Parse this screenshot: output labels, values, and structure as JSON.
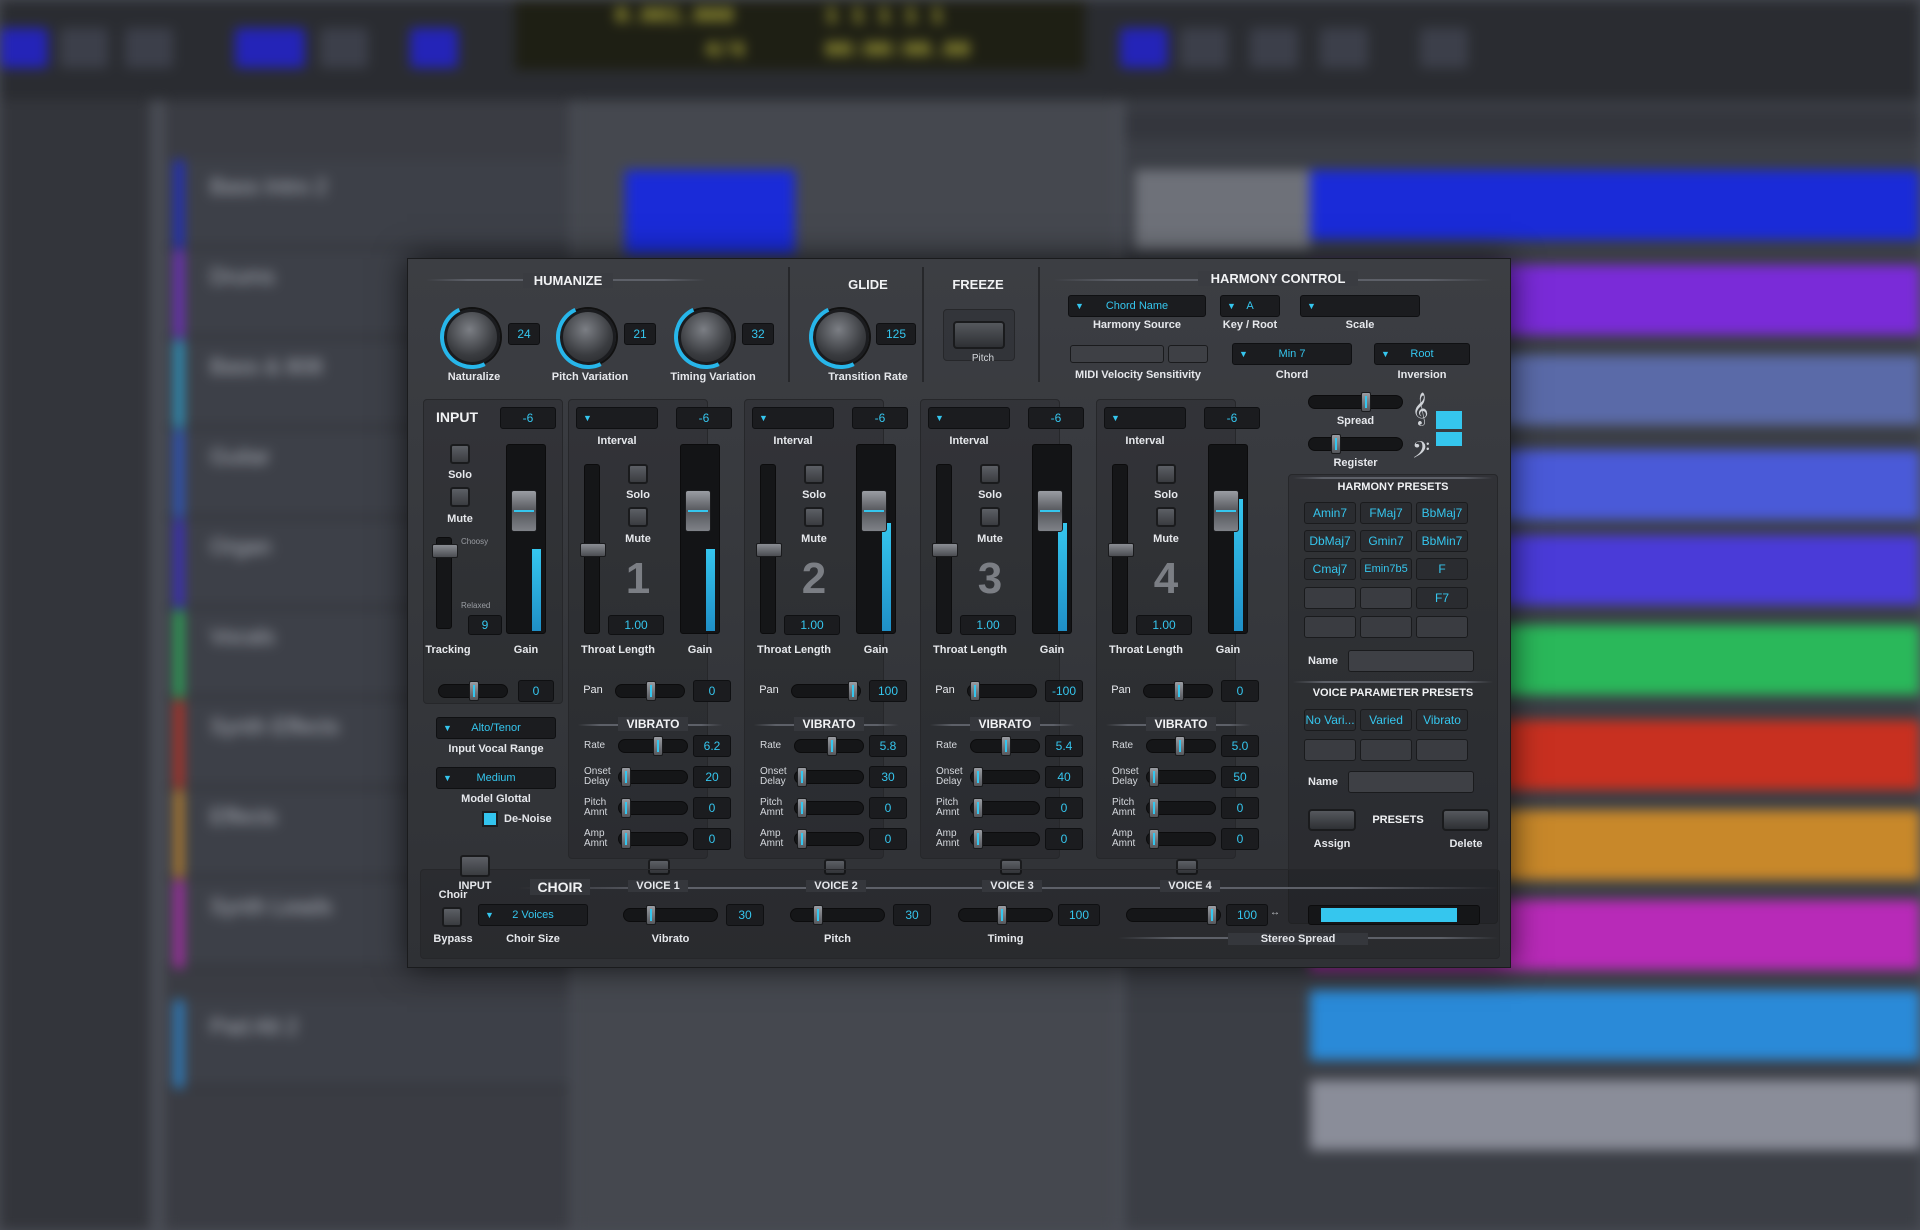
{
  "colors": {
    "accent": "#35c6ee",
    "panel": "#34363b"
  },
  "humanize": {
    "title": "HUMANIZE",
    "naturalize": {
      "label": "Naturalize",
      "value": "24"
    },
    "pitch_variation": {
      "label": "Pitch Variation",
      "value": "21"
    },
    "timing_variation": {
      "label": "Timing Variation",
      "value": "32"
    }
  },
  "glide": {
    "title": "GLIDE",
    "label": "Transition Rate",
    "value": "125"
  },
  "freeze": {
    "title": "FREEZE",
    "label": "Pitch"
  },
  "harmony": {
    "title": "HARMONY CONTROL",
    "source": {
      "label": "Harmony Source",
      "value": "Chord Name"
    },
    "key": {
      "label": "Key / Root",
      "value": "A"
    },
    "scale": {
      "label": "Scale",
      "value": ""
    },
    "midi_label": "MIDI Velocity Sensitivity",
    "chord": {
      "label": "Chord",
      "value": "Min 7"
    },
    "inversion": {
      "label": "Inversion",
      "value": "Root"
    },
    "spread_label": "Spread",
    "register_label": "Register"
  },
  "input": {
    "title": "INPUT",
    "gain_value": "-6",
    "solo": "Solo",
    "mute": "Mute",
    "choosy": "Choosy",
    "relaxed": "Relaxed",
    "tracking_label": "Tracking",
    "tracking_value": "9",
    "gain_label": "Gain",
    "pan_value": "0",
    "vocal_range": {
      "label": "Input Vocal Range",
      "value": "Alto/Tenor"
    },
    "glottal": {
      "label": "Model Glottal",
      "value": "Medium"
    },
    "denoise": "De-Noise"
  },
  "voices": [
    {
      "num": "1",
      "gain": "-6",
      "interval": "",
      "throat": "1.00",
      "pan": "0",
      "rate": "6.2",
      "onset": "20",
      "pitch": "0",
      "amp": "0"
    },
    {
      "num": "2",
      "gain": "-6",
      "interval": "",
      "throat": "1.00",
      "pan": "100",
      "rate": "5.8",
      "onset": "30",
      "pitch": "0",
      "amp": "0"
    },
    {
      "num": "3",
      "gain": "-6",
      "interval": "",
      "throat": "1.00",
      "pan": "-100",
      "rate": "5.4",
      "onset": "40",
      "pitch": "0",
      "amp": "0"
    },
    {
      "num": "4",
      "gain": "-6",
      "interval": "",
      "throat": "1.00",
      "pan": "0",
      "rate": "5.0",
      "onset": "50",
      "pitch": "0",
      "amp": "0"
    }
  ],
  "voice_labels": {
    "interval": "Interval",
    "solo": "Solo",
    "mute": "Mute",
    "throat": "Throat Length",
    "gain": "Gain",
    "pan": "Pan",
    "vibrato": "VIBRATO",
    "rate": "Rate",
    "onset": "Onset Delay",
    "pitch": "Pitch Amnt",
    "amp": "Amp Amnt"
  },
  "harmony_presets": {
    "title": "HARMONY PRESETS",
    "items": [
      "Amin7",
      "FMaj7",
      "BbMaj7",
      "DbMaj7",
      "Gmin7",
      "BbMin7",
      "Cmaj7",
      "Emin7b5",
      "F",
      "",
      "",
      "F7",
      "",
      "",
      ""
    ],
    "name_label": "Name"
  },
  "voice_presets": {
    "title": "VOICE PARAMETER PRESETS",
    "items": [
      "No Vari...",
      "Varied",
      "Vibrato",
      "",
      "",
      ""
    ],
    "name_label": "Name",
    "presets_label": "PRESETS",
    "assign": "Assign",
    "delete": "Delete"
  },
  "choir": {
    "choir_label": "Choir",
    "bypass": "Bypass",
    "input": "INPUT",
    "title": "CHOIR",
    "voice1": "VOICE 1",
    "voice2": "VOICE 2",
    "voice3": "VOICE 3",
    "voice4": "VOICE 4",
    "size": {
      "label": "Choir Size",
      "value": "2 Voices"
    },
    "vibrato": {
      "label": "Vibrato",
      "value": "30"
    },
    "pitch": {
      "label": "Pitch",
      "value": "30"
    },
    "timing": {
      "label": "Timing",
      "value": "100"
    },
    "spread": {
      "label": "Stereo Spread",
      "value": "100"
    }
  },
  "background": {
    "lcd": [
      "0.001.000",
      "1 1 1 1 1",
      "4/4",
      "00:00:00.00"
    ],
    "tracks": [
      "Bass Intro 2",
      "Drums",
      "Bass & 808",
      "Guitar",
      "Organ",
      "Vocals",
      "Synth Effects",
      "Effects",
      "Synth Leads",
      "Pad Alt 2"
    ]
  }
}
